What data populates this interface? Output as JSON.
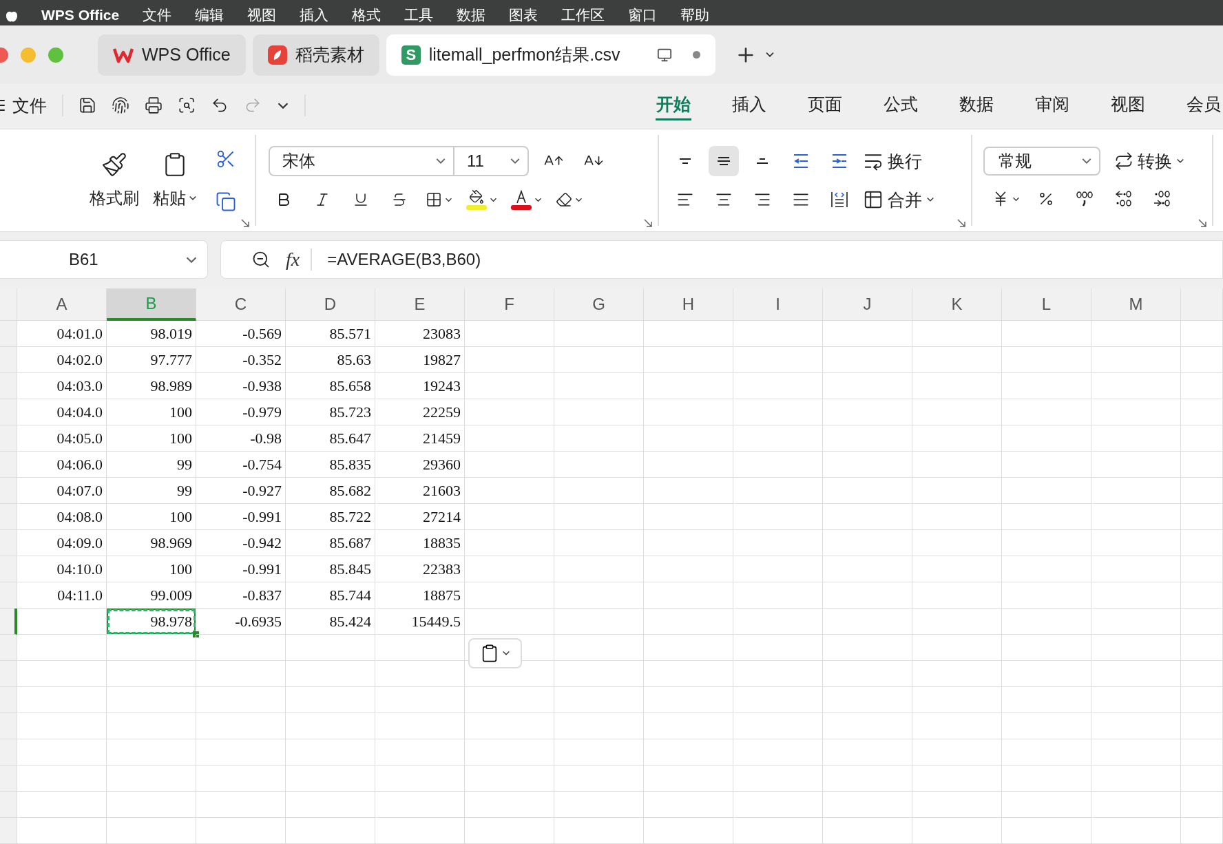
{
  "menu_bar": {
    "app_name": "WPS Office",
    "items": [
      "文件",
      "编辑",
      "视图",
      "插入",
      "格式",
      "工具",
      "数据",
      "图表",
      "工作区",
      "窗口",
      "帮助"
    ]
  },
  "tabs": [
    {
      "label": "WPS Office",
      "kind": "wps",
      "selected": false
    },
    {
      "label": "稻壳素材",
      "kind": "daoke",
      "selected": false
    },
    {
      "label": "litemall_perfmon结果.csv",
      "kind": "sheet",
      "icon_letter": "S",
      "selected": true
    }
  ],
  "quick_bar": {
    "file_label": "文件"
  },
  "ribbon_tabs": [
    {
      "label": "开始",
      "selected": true
    },
    {
      "label": "插入",
      "selected": false
    },
    {
      "label": "页面",
      "selected": false
    },
    {
      "label": "公式",
      "selected": false
    },
    {
      "label": "数据",
      "selected": false
    },
    {
      "label": "审阅",
      "selected": false
    },
    {
      "label": "视图",
      "selected": false
    },
    {
      "label": "会员",
      "selected": false
    }
  ],
  "ribbon": {
    "format_painter": "格式刷",
    "paste": "粘贴",
    "font": "宋体",
    "size": "11",
    "wrap": "换行",
    "merge": "合并",
    "number_format": "常规",
    "convert": "转换"
  },
  "vertical_align": [
    {
      "kind": "top",
      "selected": false
    },
    {
      "kind": "middle",
      "selected": true
    },
    {
      "kind": "bottom",
      "selected": false
    }
  ],
  "name_box": "B61",
  "fx_label": "fx",
  "formula": "=AVERAGE(B3,B60)",
  "columns": [
    {
      "label": "A",
      "selected": false
    },
    {
      "label": "B",
      "selected": true
    },
    {
      "label": "C",
      "selected": false
    },
    {
      "label": "D",
      "selected": false
    },
    {
      "label": "E",
      "selected": false
    },
    {
      "label": "F",
      "selected": false
    },
    {
      "label": "G",
      "selected": false
    },
    {
      "label": "H",
      "selected": false
    },
    {
      "label": "I",
      "selected": false
    },
    {
      "label": "J",
      "selected": false
    },
    {
      "label": "K",
      "selected": false
    },
    {
      "label": "L",
      "selected": false
    },
    {
      "label": "M",
      "selected": false
    }
  ],
  "rows": [
    {
      "selected": false,
      "cells": [
        "04:01.0",
        "98.019",
        "-0.569",
        "85.571",
        "23083"
      ]
    },
    {
      "selected": false,
      "cells": [
        "04:02.0",
        "97.777",
        "-0.352",
        "85.63",
        "19827"
      ]
    },
    {
      "selected": false,
      "cells": [
        "04:03.0",
        "98.989",
        "-0.938",
        "85.658",
        "19243"
      ]
    },
    {
      "selected": false,
      "cells": [
        "04:04.0",
        "100",
        "-0.979",
        "85.723",
        "22259"
      ]
    },
    {
      "selected": false,
      "cells": [
        "04:05.0",
        "100",
        "-0.98",
        "85.647",
        "21459"
      ]
    },
    {
      "selected": false,
      "cells": [
        "04:06.0",
        "99",
        "-0.754",
        "85.835",
        "29360"
      ]
    },
    {
      "selected": false,
      "cells": [
        "04:07.0",
        "99",
        "-0.927",
        "85.682",
        "21603"
      ]
    },
    {
      "selected": false,
      "cells": [
        "04:08.0",
        "100",
        "-0.991",
        "85.722",
        "27214"
      ]
    },
    {
      "selected": false,
      "cells": [
        "04:09.0",
        "98.969",
        "-0.942",
        "85.687",
        "18835"
      ]
    },
    {
      "selected": false,
      "cells": [
        "04:10.0",
        "100",
        "-0.991",
        "85.845",
        "22383"
      ]
    },
    {
      "selected": false,
      "cells": [
        "04:11.0",
        "99.009",
        "-0.837",
        "85.744",
        "18875"
      ]
    },
    {
      "selected": true,
      "cells": [
        null,
        "98.978",
        "-0.6935",
        "85.424",
        "15449.5"
      ]
    }
  ]
}
